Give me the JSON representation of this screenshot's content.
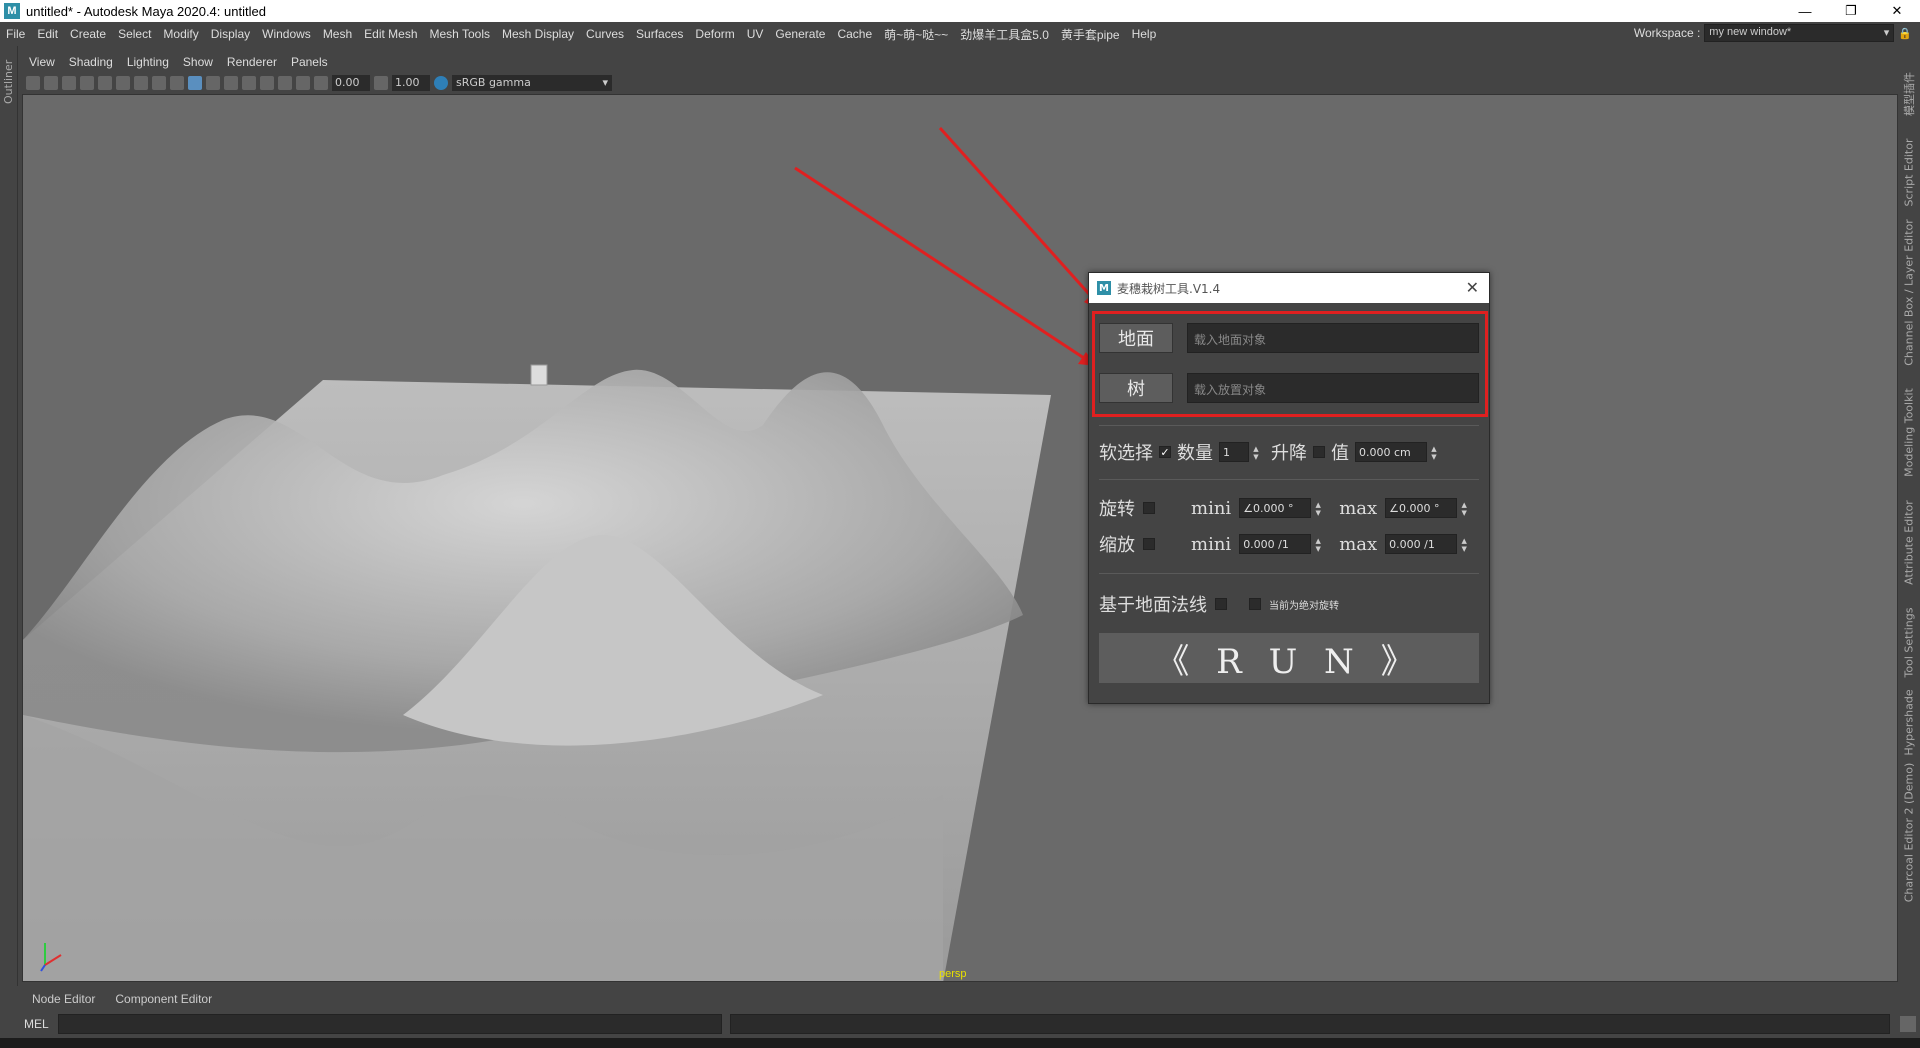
{
  "window": {
    "title": "untitled* - Autodesk Maya 2020.4: untitled",
    "logo": "M",
    "min": "—",
    "max": "❐",
    "close": "✕"
  },
  "menubar": {
    "items": [
      "File",
      "Edit",
      "Create",
      "Select",
      "Modify",
      "Display",
      "Windows",
      "Mesh",
      "Edit Mesh",
      "Mesh Tools",
      "Mesh Display",
      "Curves",
      "Surfaces",
      "Deform",
      "UV",
      "Generate",
      "Cache",
      "萌~萌~哒~~",
      "劲爆羊工具盒5.0",
      "黄手套pipe",
      "Help"
    ],
    "workspace_label": "Workspace :",
    "workspace_value": "my new window*"
  },
  "left_strip": {
    "label": "Outliner"
  },
  "right_strip": {
    "tabs": [
      "模型插件",
      "Script Editor",
      "Channel Box / Layer Editor",
      "Modeling Toolkit",
      "Attribute Editor",
      "Tool Settings",
      "Hypershade",
      "Charcoal Editor 2 (Demo)"
    ]
  },
  "panel_menu": {
    "items": [
      "View",
      "Shading",
      "Lighting",
      "Show",
      "Renderer",
      "Panels"
    ]
  },
  "toolbar": {
    "exposure": "0.00",
    "gamma_value": "1.00",
    "color_space": "sRGB gamma"
  },
  "viewport": {
    "camera_label": "persp"
  },
  "bottom_tabs": [
    "Node Editor",
    "Component Editor"
  ],
  "command_line": {
    "label": "MEL"
  },
  "tool": {
    "title": "麦穗栽树工具.V1.4",
    "logo": "M",
    "close": "✕",
    "ground_button": "地面",
    "ground_placeholder": "载入地面对象",
    "tree_button": "树",
    "tree_placeholder": "载入放置对象",
    "soft_select_label": "软选择",
    "soft_select_checked": true,
    "count_label": "数量",
    "count_value": "1",
    "raise_label": "升降",
    "value_label": "值",
    "value_field": "0.000 cm",
    "rotate_label": "旋转",
    "scale_label": "缩放",
    "mini_label": "mini",
    "max_label": "max",
    "rotate_min": "∠0.000 °",
    "rotate_max": "∠0.000 °",
    "scale_min": "0.000 /1",
    "scale_max": "0.000 /1",
    "normal_label": "基于地面法线",
    "absolute_label": "当前为绝对旋转",
    "run_label": "《 R U N 》"
  },
  "colors": {
    "annotation": "#e02020",
    "viewport_bg": "#6a6a6a",
    "maya_logo": "#2e8fa7"
  }
}
